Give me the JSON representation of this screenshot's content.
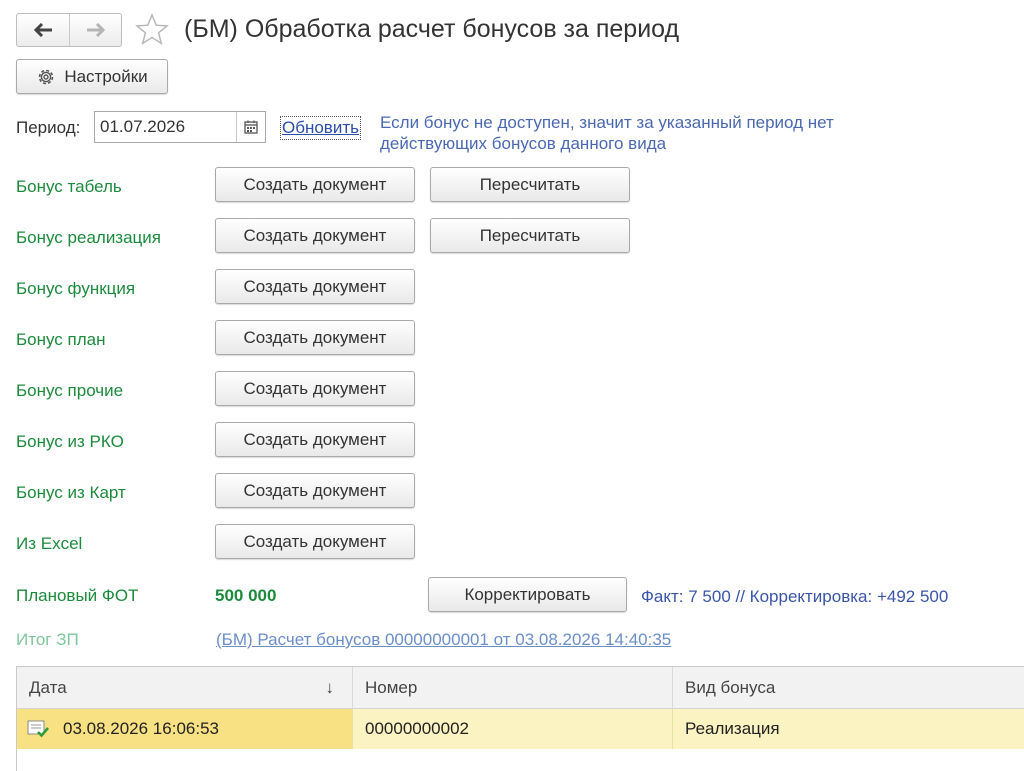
{
  "header": {
    "title": "(БМ) Обработка расчет бонусов за период",
    "back_icon": "arrow-left-icon",
    "forward_icon": "arrow-right-icon",
    "favorite_icon": "star-icon"
  },
  "toolbar": {
    "settings_label": "Настройки",
    "settings_icon": "gear-icon"
  },
  "period": {
    "label": "Период:",
    "value": "01.07.2026",
    "calendar_icon": "calendar-icon",
    "refresh_label": "Обновить",
    "hint": "Если бонус не доступен, значит за указанный период нет действующих бонусов данного вида"
  },
  "bonuses": [
    {
      "label": "Бонус табель",
      "create_label": "Создать документ",
      "recalc_label": "Пересчитать"
    },
    {
      "label": "Бонус реализация",
      "create_label": "Создать документ",
      "recalc_label": "Пересчитать"
    },
    {
      "label": "Бонус функция",
      "create_label": "Создать документ"
    },
    {
      "label": "Бонус план",
      "create_label": "Создать документ"
    },
    {
      "label": "Бонус прочие",
      "create_label": "Создать документ"
    },
    {
      "label": "Бонус из РКО",
      "create_label": "Создать документ"
    },
    {
      "label": "Бонус из Карт",
      "create_label": "Создать документ"
    },
    {
      "label": "Из Excel",
      "create_label": "Создать документ"
    }
  ],
  "fot": {
    "label": "Плановый ФОТ",
    "value": "500 000",
    "correct_label": "Корректировать",
    "fact": "Факт: 7 500 // Корректировка: +492 500"
  },
  "itog": {
    "label": "Итог ЗП",
    "link": "(БМ) Расчет бонусов 00000000001 от 03.08.2026 14:40:35"
  },
  "table": {
    "columns": [
      "Дата",
      "Номер",
      "Вид бонуса"
    ],
    "sort_indicator": "↓",
    "rows": [
      {
        "date": "03.08.2026 16:06:53",
        "number": "00000000002",
        "type": "Реализация",
        "status_icon": "document-posted-icon"
      }
    ]
  },
  "colors": {
    "label_green": "#1c8a3c",
    "link_blue": "#2a4ea8",
    "hint_blue": "#4a68b2",
    "selected_row": "#fbf3c2"
  }
}
